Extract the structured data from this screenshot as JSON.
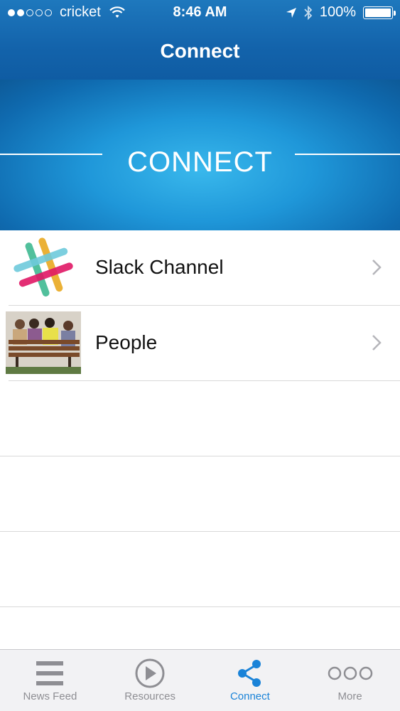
{
  "status_bar": {
    "carrier": "cricket",
    "time": "8:46 AM",
    "battery": "100%",
    "battery_level": 1.0,
    "signal_bars_filled": 2,
    "signal_bars_total": 5
  },
  "nav": {
    "title": "Connect"
  },
  "hero": {
    "title": "CONNECT"
  },
  "list": {
    "items": [
      {
        "label": "Slack Channel",
        "icon": "slack-logo-icon"
      },
      {
        "label": "People",
        "icon": "people-photo"
      }
    ]
  },
  "tabbar": {
    "tabs": [
      {
        "label": "News Feed",
        "icon": "hamburger-icon"
      },
      {
        "label": "Resources",
        "icon": "play-circle-icon"
      },
      {
        "label": "Connect",
        "icon": "share-icon",
        "active": true
      },
      {
        "label": "More",
        "icon": "more-icon"
      }
    ]
  },
  "colors": {
    "nav_bar": "#1363ab",
    "hero": "#1f97d9",
    "active_tab": "#1a83d8",
    "inactive_tab": "#8e8e93"
  }
}
